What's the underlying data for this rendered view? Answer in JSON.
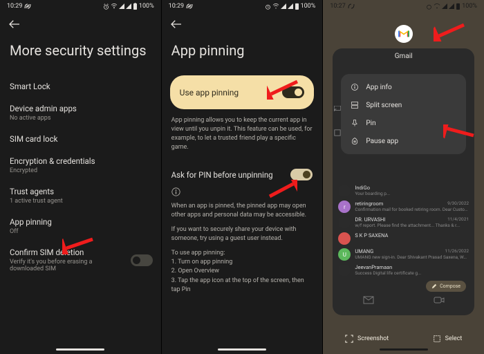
{
  "colors": {
    "accent": "#f5dfa7",
    "arrow": "#ef1c1c"
  },
  "status": {
    "time1": "10:29",
    "time2": "10:29",
    "time3": "10:27",
    "battery": "100%"
  },
  "screen1": {
    "title": "More security settings",
    "items": [
      {
        "title": "Smart Lock",
        "sub": ""
      },
      {
        "title": "Device admin apps",
        "sub": "No active apps"
      },
      {
        "title": "SIM card lock",
        "sub": ""
      },
      {
        "title": "Encryption & credentials",
        "sub": "Encrypted"
      },
      {
        "title": "Trust agents",
        "sub": "1 active trust agent"
      },
      {
        "title": "App pinning",
        "sub": "Off"
      },
      {
        "title": "Confirm SIM deletion",
        "sub": "Verify it's you before erasing a downloaded SIM",
        "toggle": false
      }
    ]
  },
  "screen2": {
    "title": "App pinning",
    "main_toggle_label": "Use app pinning",
    "main_toggle_on": true,
    "desc": "App pinning allows you to keep the current app in view until you unpin it. This feature can be used, for example, to let a trusted friend play a specific game.",
    "ask_label": "Ask for PIN before unpinning",
    "ask_on": true,
    "info1": "When an app is pinned, the pinned app may open other apps and personal data may be accessible.",
    "info2": "If you want to securely share your device with someone, try using a guest user instead.",
    "how_to_label": "To use app pinning:",
    "how_to_steps": [
      "1. Turn on app pinning",
      "2. Open Overview",
      "3. Tap the app icon at the top of the screen, then tap Pin"
    ]
  },
  "screen3": {
    "app_name": "Gmail",
    "menu": [
      {
        "icon": "info",
        "label": "App info"
      },
      {
        "icon": "split",
        "label": "Split screen"
      },
      {
        "icon": "pin",
        "label": "Pin"
      },
      {
        "icon": "pause",
        "label": "Pause app"
      }
    ],
    "mails": [
      {
        "sender": "IndiGo",
        "subj": "Your boarding p...",
        "date": "",
        "color": "#2b2b2b"
      },
      {
        "sender": "retiringroom",
        "subj": "Confirmation mail for booked retiring room. Dear Customer Thank you for using IRCTC's...",
        "date": "9/30/2022",
        "color": "#a872c9"
      },
      {
        "sender": "DR. URVASHI",
        "subj": "w/f report. Please find the attachment... Thanks & r...",
        "date": "11/4/2021",
        "color": "#2b2b2b"
      },
      {
        "sender": "S K P SAXENA",
        "subj": "",
        "date": "",
        "color": "#d9534f"
      },
      {
        "sender": "UMANG",
        "subj": "UMANG new sign-in. Dear Shivakant Prasad Saxena, We noticed a...",
        "date": "11/26/2022",
        "color": "#5cb85c"
      },
      {
        "sender": "JeevanPramaan",
        "subj": "Success Digital life certificate g...",
        "date": "",
        "color": "#2b2b2b"
      }
    ],
    "compose_label": "Compose",
    "actions": {
      "screenshot": "Screenshot",
      "select": "Select"
    }
  }
}
